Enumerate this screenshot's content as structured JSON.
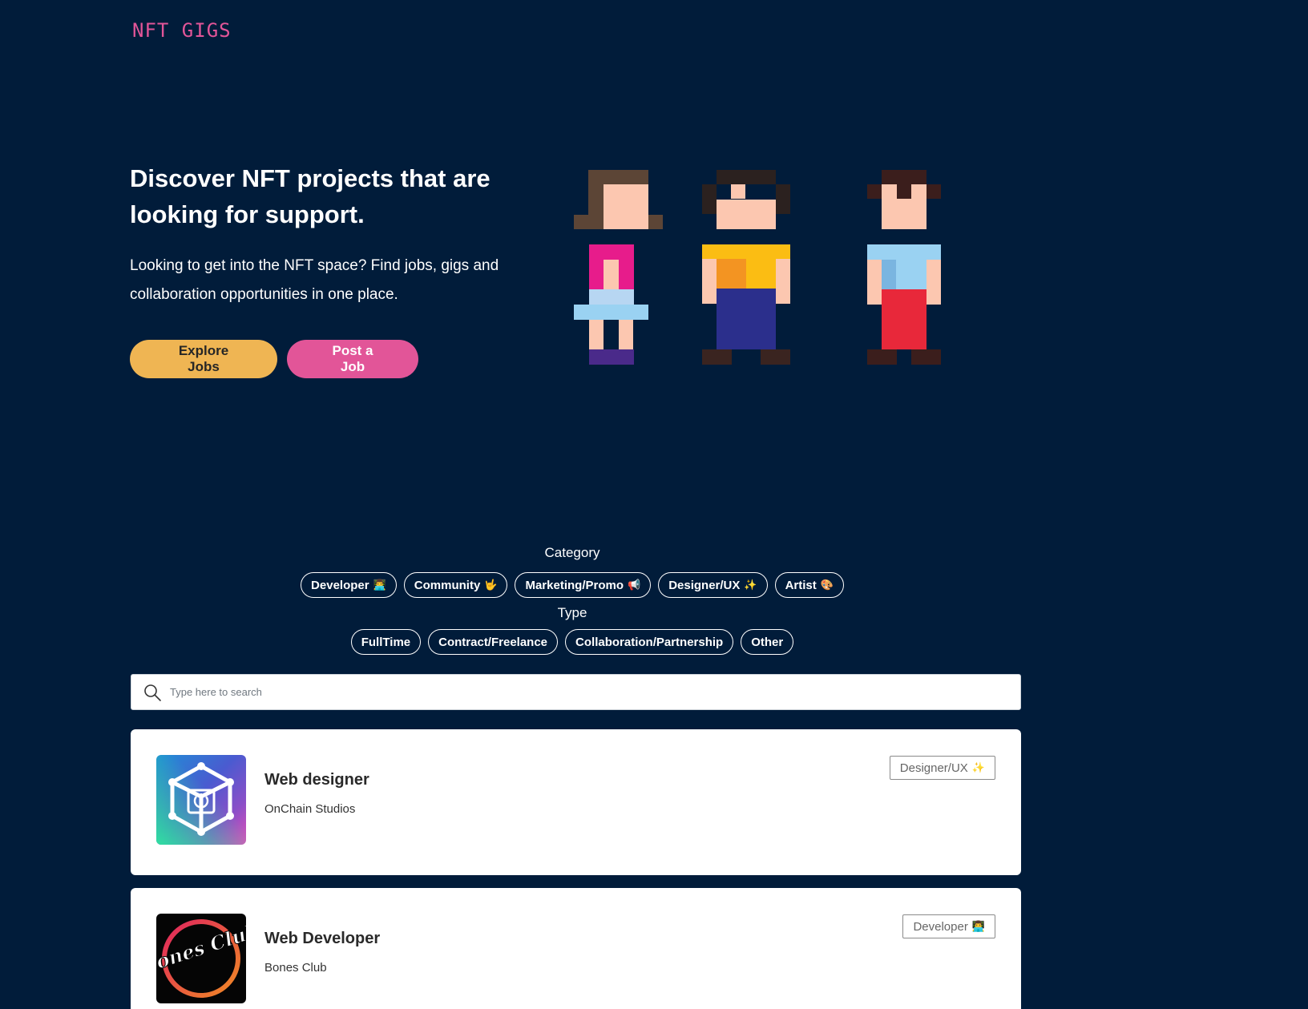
{
  "header": {
    "logo": "NFT GIGS"
  },
  "hero": {
    "title": "Discover NFT projects that are looking for support.",
    "subtitle": "Looking to get into the NFT space? Find jobs, gigs and collaboration opportunities in one place.",
    "explore_label": "Explore Jobs",
    "post_label": "Post a Job"
  },
  "colors": {
    "background": "#011c3a",
    "accent_pink": "#e25598",
    "accent_yellow": "#efb553"
  },
  "filters": {
    "category_label": "Category",
    "categories": [
      {
        "label": "Developer",
        "emoji": "👨‍💻"
      },
      {
        "label": "Community",
        "emoji": "🤟"
      },
      {
        "label": "Marketing/Promo",
        "emoji": "📢"
      },
      {
        "label": "Designer/UX",
        "emoji": "✨"
      },
      {
        "label": "Artist",
        "emoji": "🎨"
      }
    ],
    "type_label": "Type",
    "types": [
      {
        "label": "FullTime"
      },
      {
        "label": "Contract/Freelance"
      },
      {
        "label": "Collaboration/Partnership"
      },
      {
        "label": "Other"
      }
    ]
  },
  "search": {
    "placeholder": "Type here to search",
    "icon": "search-icon"
  },
  "jobs": [
    {
      "title": "Web designer",
      "company": "OnChain Studios",
      "badge": "Designer/UX",
      "badge_emoji": "✨",
      "logo": "onchain-studios-logo"
    },
    {
      "title": "Web Developer",
      "company": "Bones Club",
      "badge": "Developer",
      "badge_emoji": "👨‍💻",
      "logo": "bones-club-logo",
      "logo_text": "Bones Club"
    }
  ]
}
